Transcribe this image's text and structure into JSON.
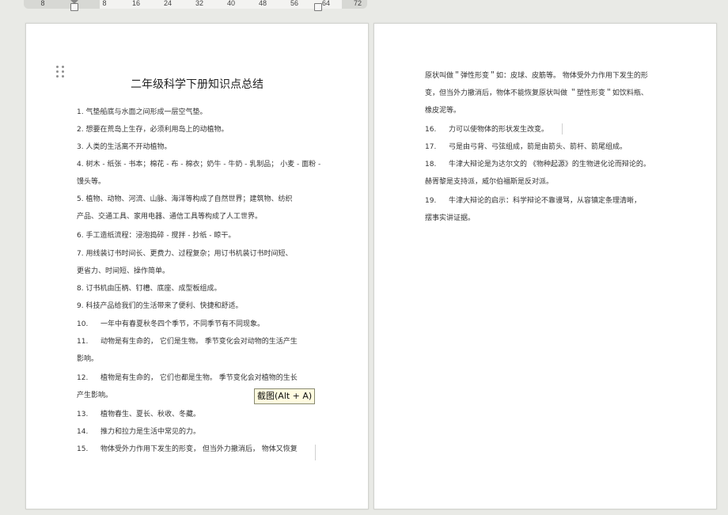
{
  "ruler": {
    "labels": [
      "8",
      "8",
      "16",
      "24",
      "32",
      "40",
      "48",
      "56",
      "64",
      "72"
    ]
  },
  "page1": {
    "title": "二年级科学下册知识点总结",
    "items": [
      {
        "n": "1.",
        "text": "气垫船底与水面之间形成一层空气垫。"
      },
      {
        "n": "2.",
        "text": "想要在荒岛上生存，必须利用岛上的动植物。"
      },
      {
        "n": "3.",
        "text": "人类的生活离不开动植物。"
      },
      {
        "n": "4.",
        "text": "树木 - 纸张 - 书本；棉花 - 布 - 棉衣；奶牛 - 牛奶 - 乳制品；  小麦 - 面粉 -",
        "cont": "馒头等。"
      },
      {
        "n": "5.",
        "text": "植物、动物、河流、山脉、海洋等构成了自然世界；建筑物、纺织",
        "cont": "产品、交通工具、家用电器、通信工具等构成了人工世界。"
      },
      {
        "n": "6.",
        "text": "手工造纸流程：浸泡捣碎  - 搅拌 - 抄纸 - 晾干。"
      },
      {
        "n": "7.",
        "text": "用线装订书时间长、更费力、过程复杂；用订书机装订书时间短、",
        "cont": "更省力、时间短、操作简单。"
      },
      {
        "n": "8.",
        "text": "订书机由压柄、钉槽、底座、成型板组成。"
      },
      {
        "n": "9.",
        "text": "科技产品给我们的生活带来了便利、快捷和舒适。"
      },
      {
        "n": "10.",
        "text": "一年中有春夏秋冬四个季节，不同季节有不同现象。"
      },
      {
        "n": "11.",
        "text": "动物是有生命的，  它们是生物。  季节变化会对动物的生活产生",
        "cont": "影响。"
      },
      {
        "n": "12.",
        "text": "植物是有生命的，  它们也都是生物。  季节变化会对植物的生长",
        "cont": "产生影响。"
      },
      {
        "n": "13.",
        "text": "植物春生、夏长、秋收、冬藏。"
      },
      {
        "n": "14.",
        "text": "推力和拉力是生活中常见的力。"
      },
      {
        "n": "15.",
        "text": "物体受外力作用下发生的形变，  但当外力撤消后，  物体又恢复"
      }
    ]
  },
  "page2": {
    "lines": [
      {
        "text": "原状叫做＂弹性形变＂如：皮球、皮筋等。  物体受外力作用下发生的形"
      },
      {
        "text": "变，但当外力撤消后，物体不能恢复原状叫做    ＂塑性形变＂如饮料瓶、"
      },
      {
        "text": "橡皮泥等。"
      },
      {
        "n": "16.",
        "text": "力可以使物体的形状发生改变。"
      },
      {
        "n": "17.",
        "text": "弓是由弓背、弓弦组成，箭是由箭头、箭杆、箭尾组成。"
      },
      {
        "n": "18.",
        "text": "牛津大辩论是为达尔文的  《物种起源》的生物进化论而辩论的。"
      },
      {
        "text": "赫胥黎是支持派，威尔伯福斯是反对派。"
      },
      {
        "n": "19.",
        "text": "牛津大辩论的启示：科学辩论不靠谩骂，从容镇定条理清晰，"
      },
      {
        "text": "摆事实讲证据。"
      }
    ]
  },
  "tooltip": "截图(Alt + A)"
}
